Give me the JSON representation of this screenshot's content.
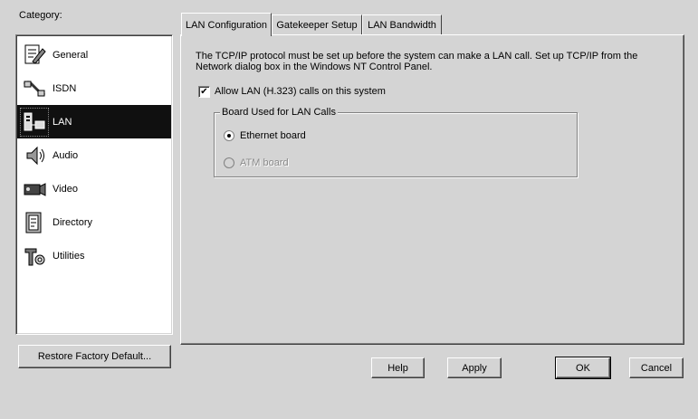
{
  "category": {
    "label": "Category:",
    "items": [
      {
        "label": "General",
        "icon": "general-icon"
      },
      {
        "label": "ISDN",
        "icon": "isdn-icon"
      },
      {
        "label": "LAN",
        "icon": "lan-icon",
        "selected": true
      },
      {
        "label": "Audio",
        "icon": "audio-icon"
      },
      {
        "label": "Video",
        "icon": "video-icon"
      },
      {
        "label": "Directory",
        "icon": "directory-icon"
      },
      {
        "label": "Utilities",
        "icon": "utilities-icon"
      }
    ],
    "selection_color": "#101010"
  },
  "restore_button": "Restore Factory Default...",
  "tabs": [
    {
      "label": "LAN Configuration",
      "active": true
    },
    {
      "label": "Gatekeeper Setup"
    },
    {
      "label": "LAN Bandwidth"
    }
  ],
  "lan": {
    "description": "The TCP/IP protocol must be set up before the system can make a LAN call. Set up TCP/IP from the Network dialog box in the Windows NT Control Panel.",
    "allow_checkbox": {
      "label": "Allow LAN (H.323) calls on this system",
      "checked": true,
      "mark": "✔"
    },
    "board_group": {
      "title": "Board Used for LAN Calls",
      "options": [
        {
          "label": "Ethernet board",
          "selected": true,
          "enabled": true
        },
        {
          "label": "ATM board",
          "selected": false,
          "enabled": false
        }
      ]
    }
  },
  "buttons": {
    "help": "Help",
    "apply": "Apply",
    "ok": "OK",
    "cancel": "Cancel"
  }
}
